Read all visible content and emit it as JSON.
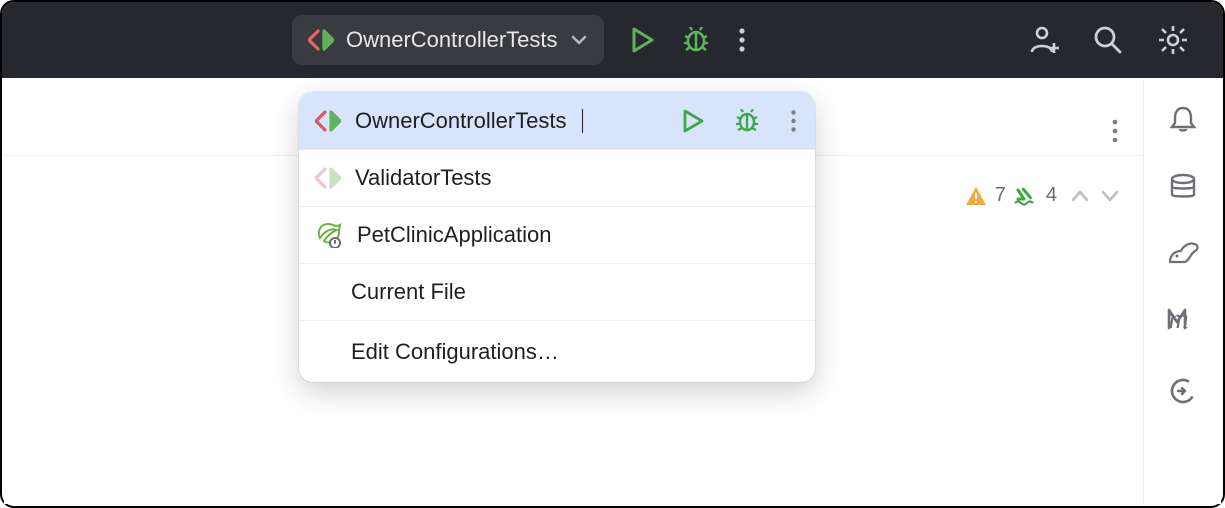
{
  "topbar": {
    "run_config_label": "OwnerControllerTests"
  },
  "dropdown": {
    "items": [
      {
        "label": "OwnerControllerTests",
        "icon": "test-config",
        "selected": true,
        "actions": true
      },
      {
        "label": "ValidatorTests",
        "icon": "test-config-muted"
      },
      {
        "label": "PetClinicApplication",
        "icon": "spring-app"
      },
      {
        "label": "Current File",
        "icon": null
      },
      {
        "label": "Edit Configurations…",
        "icon": null
      }
    ]
  },
  "editor_status": {
    "warnings": "7",
    "weak_warnings": "4"
  },
  "colors": {
    "run_green": "#5fb35a",
    "bug_green": "#4aa24b",
    "accent_select": "#d7e4fc",
    "warn_yellow": "#f2a93b",
    "ok_green": "#3fa64a",
    "spring": "#6db33f",
    "test_red": "#d85c5c"
  }
}
